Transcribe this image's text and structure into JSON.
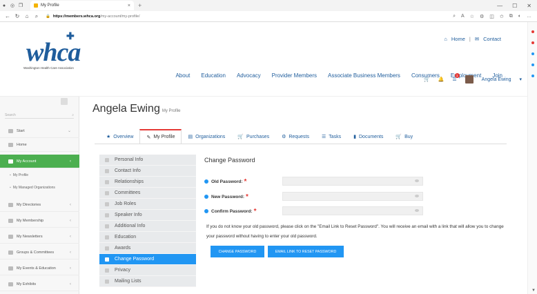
{
  "browser": {
    "tab_title": "My Profile",
    "tab_close": "×",
    "new_tab": "+",
    "url_domain": "https://members.whca.org",
    "url_path": "/my-account/my-profile/",
    "win_controls": [
      "—",
      "☐",
      "✕"
    ]
  },
  "site": {
    "logo_text": "whca",
    "logo_tagline": "Washington Health Care Association",
    "top_links": {
      "home": "Home",
      "sep": "|",
      "contact": "Contact"
    },
    "main_nav": [
      "About",
      "Education",
      "Advocacy",
      "Provider Members",
      "Associate Business Members",
      "Consumers",
      "Employment",
      "Join"
    ],
    "user": {
      "name": "Angela Ewing",
      "notif_count": "1"
    }
  },
  "sidebar": {
    "search_placeholder": "Search",
    "items": [
      {
        "label": "Start",
        "chev": "⌄"
      },
      {
        "label": "Home"
      },
      {
        "label": "My Account",
        "chev": "‹"
      }
    ],
    "sub_items": [
      "My Profile",
      "My Managed Organizations"
    ],
    "more": [
      {
        "label": "My Directories",
        "chev": "‹"
      },
      {
        "label": "My Membership",
        "chev": "‹"
      },
      {
        "label": "My Newsletters",
        "chev": "‹"
      },
      {
        "label": "Groups & Committees",
        "chev": "‹"
      },
      {
        "label": "My Events & Education",
        "chev": "‹"
      },
      {
        "label": "My Exhibits",
        "chev": "‹"
      }
    ]
  },
  "page": {
    "title": "Angela Ewing",
    "subtitle": "My Profile",
    "tabs": [
      {
        "icon": "★",
        "label": "Overview"
      },
      {
        "icon": "✎",
        "label": "My Profile"
      },
      {
        "icon": "▤",
        "label": "Organizations"
      },
      {
        "icon": "🛒",
        "label": "Purchases"
      },
      {
        "icon": "⚙",
        "label": "Requests"
      },
      {
        "icon": "☰",
        "label": "Tasks"
      },
      {
        "icon": "▮",
        "label": "Documents"
      },
      {
        "icon": "🛒",
        "label": "Buy"
      }
    ],
    "subnav": [
      "Personal Info",
      "Contact Info",
      "Relationships",
      "Committees",
      "Job Roles",
      "Speaker Info",
      "Additional Info",
      "Education",
      "Awards",
      "Change Password",
      "Privacy",
      "Mailing Lists"
    ]
  },
  "form": {
    "title": "Change Password",
    "old_label": "Old Password:",
    "new_label": "New Password:",
    "confirm_label": "Confirm Password:",
    "required_mark": "*",
    "note": "If you do not know your old password, please click on the \"Email Link to Reset Password\". You will receive an email with a link that will allow you to change your password without having to enter your old password.",
    "change_button": "CHANGE PASSWORD",
    "reset_button": "EMAIL LINK TO RESET PASSWORD"
  },
  "colors": {
    "brand_blue": "#1f5d9c",
    "active_green": "#4caf50",
    "accent_blue": "#2196f3",
    "required_red": "#e53935"
  }
}
